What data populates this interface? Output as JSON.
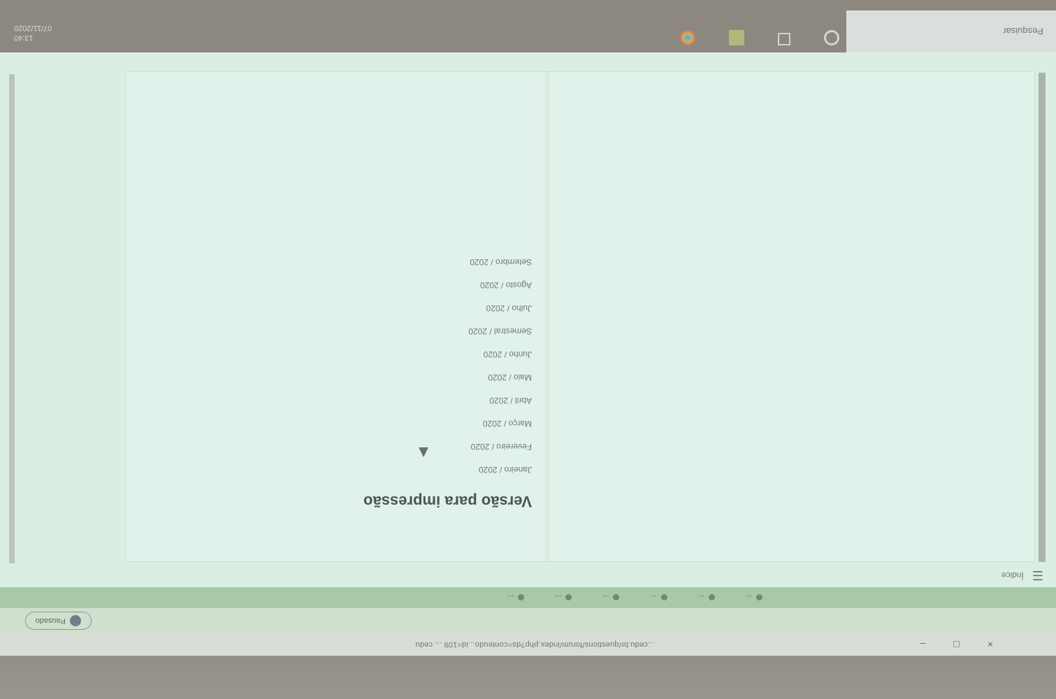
{
  "browser": {
    "window_controls": [
      "×",
      "□",
      "–"
    ],
    "url": "...cedu.br/questions/forum/index.php?ds=conteudo...id=109 ... cedu",
    "profile_label": "Pausado",
    "bookmarks": [
      "...",
      "...",
      "...",
      "...",
      "...",
      "..."
    ]
  },
  "page": {
    "toolbar_label": "Índice",
    "heading": "Versão para impressão",
    "months": [
      "Janeiro / 2020",
      "Fevereiro / 2020",
      "Março / 2020",
      "Abril / 2020",
      "Maio / 2020",
      "Junho / 2020",
      "Semestral / 2020",
      "Julho / 2020",
      "Agosto / 2020",
      "Setembro / 2020"
    ]
  },
  "taskbar": {
    "search_placeholder": "Pesquisar",
    "icons": [
      "cortana-icon",
      "task-view-icon",
      "file-explorer-icon",
      "chrome-icon"
    ],
    "tray_time": "13:40",
    "tray_date": "07/11/2020"
  }
}
